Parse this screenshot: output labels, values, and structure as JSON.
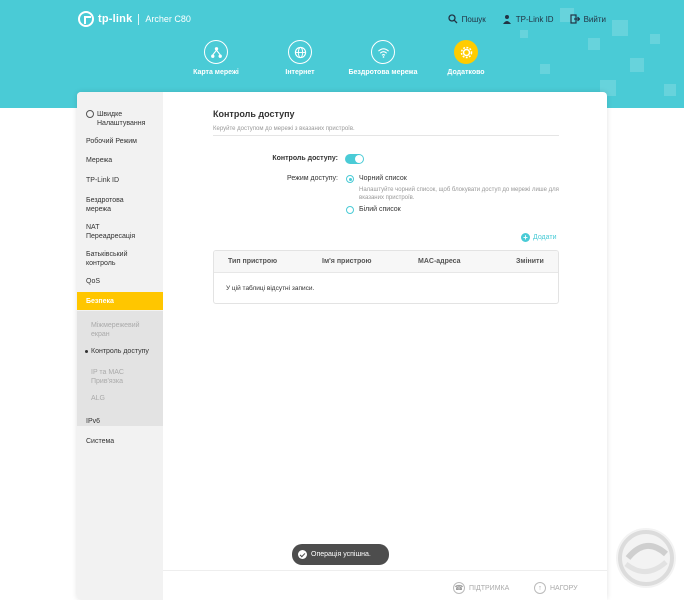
{
  "brand": {
    "logo": "tp-link",
    "model": "Archer C80"
  },
  "top_links": [
    {
      "label": "Пошук",
      "icon": "search-icon"
    },
    {
      "label": "TP-Link ID",
      "icon": "person-icon"
    },
    {
      "label": "Вийти",
      "icon": "logout-icon"
    }
  ],
  "main_nav": [
    {
      "label": "Карта мережі",
      "icon": "network-map-icon"
    },
    {
      "label": "Інтернет",
      "icon": "globe-icon"
    },
    {
      "label": "Бездротова мережа",
      "icon": "wifi-icon"
    },
    {
      "label": "Додатково",
      "icon": "gear-icon",
      "active": true
    }
  ],
  "sidebar": {
    "items": [
      {
        "label": "Швидке Налаштування",
        "icon": "gear-icon"
      },
      {
        "label": "Робочий Режим"
      },
      {
        "label": "Мережа"
      },
      {
        "label": "TP-Link ID"
      },
      {
        "label": "Бездротова мережа"
      },
      {
        "label": "NAT Переадресація"
      },
      {
        "label": "Батьківський контроль"
      },
      {
        "label": "QoS"
      },
      {
        "label": "Безпека",
        "active": true
      },
      {
        "label": "IPv6"
      },
      {
        "label": "Система"
      }
    ],
    "sub_items": [
      {
        "label": "Міжмережевий екран"
      },
      {
        "label": "Контроль доступу",
        "current": true
      },
      {
        "label": "IP та MAC Прив'язка"
      },
      {
        "label": "ALG"
      }
    ]
  },
  "content": {
    "title": "Контроль доступу",
    "description": "Керуйте доступом до мережі з вказаних пристроїв.",
    "access_control_label": "Контроль доступу:",
    "access_control_enabled": true,
    "mode_label": "Режим доступу:",
    "blacklist_label": "Чорний список",
    "blacklist_hint": "Налаштуйте чорний список, щоб блокувати доступ до мережі лише для вказаних пристроїв.",
    "whitelist_label": "Білий список",
    "selected_mode": "Чорний список",
    "add_label": "Додати",
    "table": {
      "columns": [
        "Тип пристрою",
        "Ім'я пристрою",
        "MAC-адреса",
        "Змінити"
      ],
      "empty_text": "У цій таблиці відсутні записи."
    }
  },
  "toast": {
    "text": "Операція успішна."
  },
  "footer": {
    "support_label": "ПІДТРИМКА",
    "top_label": "НАГОРУ"
  },
  "colors": {
    "header": "#4acbd6",
    "accent": "#ffc600",
    "toggle": "#4acbd6"
  }
}
